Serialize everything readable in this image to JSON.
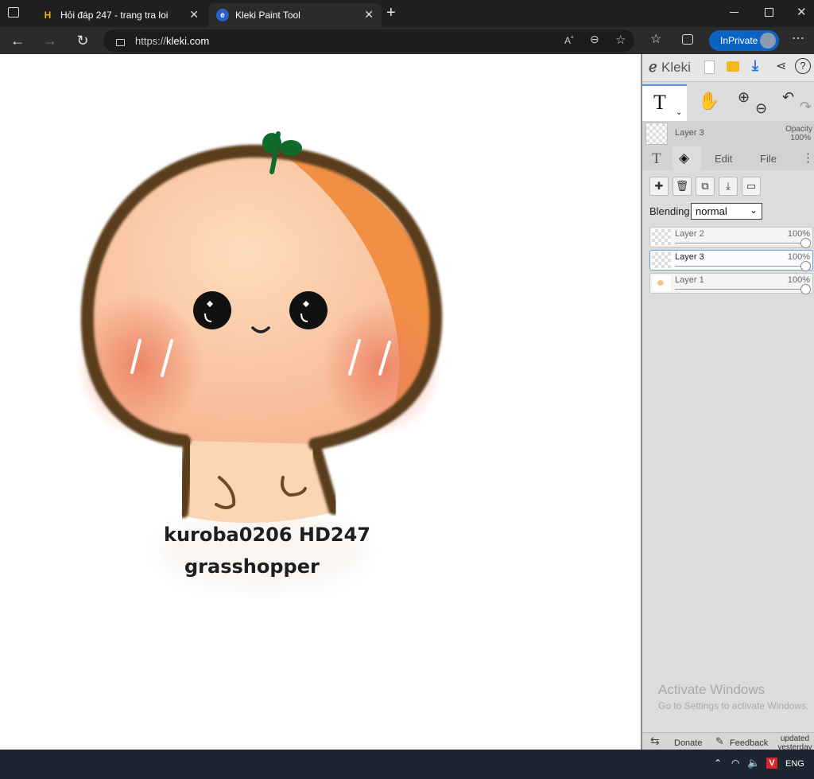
{
  "browser": {
    "tabs": [
      {
        "title": "Hỏi đáp 247 - trang tra loi",
        "icon": "hd247-favicon",
        "active": false
      },
      {
        "title": "Kleki Paint Tool",
        "icon": "kleki-favicon",
        "active": true
      }
    ],
    "new_tab_icon": "plus-icon",
    "url_prefix": "https://",
    "url_domain": "kleki.com",
    "inprivate_label": "InPrivate",
    "colors": {
      "tabbar": "#1f1f1f",
      "active_tab": "#2b2b2b",
      "inprivate": "#0b63c4"
    }
  },
  "canvas": {
    "caption_line1": "kuroba0206 HD247",
    "caption_line2": "grasshopper",
    "colors": {
      "outline": "#5a3d1e",
      "skin": "#fbd2ae",
      "blush": "#ec8a6c",
      "orange": "#f08a3a",
      "sprout": "#0f6a2c"
    }
  },
  "kleki": {
    "logo": "Kleki",
    "current_layer": "Layer 3",
    "opacity_label": "Opacity",
    "opacity_value": "100%",
    "tabs": {
      "text_tool": "T",
      "edit": "Edit",
      "file": "File"
    },
    "blending_label": "Blending",
    "blending_value": "normal",
    "layers": [
      {
        "name": "Layer 2",
        "opacity": "100%",
        "selected": false
      },
      {
        "name": "Layer 3",
        "opacity": "100%",
        "selected": true
      },
      {
        "name": "Layer 1",
        "opacity": "100%",
        "selected": false
      }
    ],
    "footer": {
      "donate": "Donate",
      "feedback": "Feedback",
      "updated": "updated yesterday"
    }
  },
  "watermark": {
    "title": "Activate Windows",
    "subtitle": "Go to Settings to activate Windows."
  },
  "taskbar": {
    "lang": "ENG"
  }
}
